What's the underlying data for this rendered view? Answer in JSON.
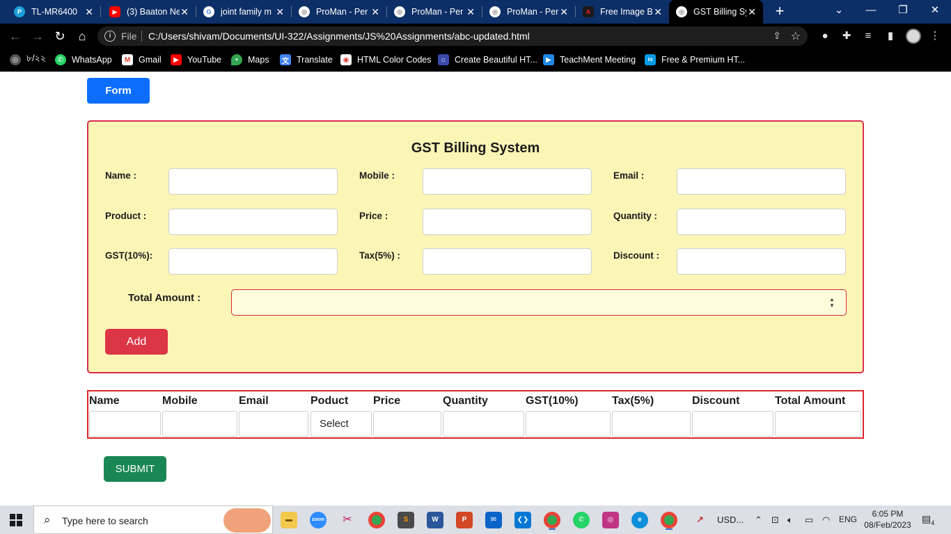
{
  "browser": {
    "tabs": [
      {
        "title": "TL-MR6400",
        "icon": "tplink-icon",
        "color": "#1aa0d8"
      },
      {
        "title": "(3) Baaton Ne",
        "icon": "youtube-icon",
        "color": "#ff0000"
      },
      {
        "title": "joint family m",
        "icon": "google-icon",
        "color": "#4285f4"
      },
      {
        "title": "ProMan - Per",
        "icon": "globe-icon",
        "color": "#3a3a3a"
      },
      {
        "title": "ProMan - Per",
        "icon": "globe-icon",
        "color": "#3a3a3a"
      },
      {
        "title": "ProMan - Per",
        "icon": "globe-icon",
        "color": "#3a3a3a"
      },
      {
        "title": "Free Image B",
        "icon": "adobe-icon",
        "color": "#e8232b"
      },
      {
        "title": "GST Billing Sy",
        "icon": "globe-icon",
        "color": "#3a3a3a"
      }
    ],
    "address": {
      "scheme_label": "File",
      "url": "C:/Users/shivam/Documents/UI-322/Assignments/JS%20Assignments/abc-updated.html"
    },
    "bookmarks": [
      {
        "label": "৮/২২",
        "icon": "globe-icon",
        "color": "#555555"
      },
      {
        "label": "WhatsApp",
        "icon": "whatsapp-icon",
        "color": "#25d366"
      },
      {
        "label": "Gmail",
        "icon": "gmail-icon",
        "color": "#ea4335"
      },
      {
        "label": "YouTube",
        "icon": "youtube-icon",
        "color": "#ff0000"
      },
      {
        "label": "Maps",
        "icon": "maps-icon",
        "color": "#34a853"
      },
      {
        "label": "Translate",
        "icon": "translate-icon",
        "color": "#4285f4"
      },
      {
        "label": "HTML Color Codes",
        "icon": "color-codes-icon",
        "color": "#e53935"
      },
      {
        "label": "Create Beautiful HT...",
        "icon": "html-template-icon",
        "color": "#3949ab"
      },
      {
        "label": "TeachMent Meeting",
        "icon": "teachment-icon",
        "color": "#1e88e5"
      },
      {
        "label": "Free & Premium HT...",
        "icon": "premium-html-icon",
        "color": "#039be5"
      }
    ]
  },
  "page": {
    "form_button": "Form",
    "title": "GST Billing System",
    "fields": {
      "name": "Name :",
      "mobile": "Mobile :",
      "email": "Email :",
      "product": "Product :",
      "price": "Price :",
      "quantity": "Quantity :",
      "gst": "GST(10%):",
      "tax": "Tax(5%) :",
      "discount": "Discount :"
    },
    "total_label": "Total Amount :",
    "add_button": "Add",
    "table": {
      "headers": [
        "Name",
        "Mobile",
        "Email",
        "Poduct",
        "Price",
        "Quantity",
        "GST(10%)",
        "Tax(5%)",
        "Discount",
        "Total Amount"
      ],
      "product_select": "Select"
    },
    "submit_button": "SUBMIT",
    "colors": {
      "card_bg": "#fbf6b6",
      "card_border": "#dc2c4f",
      "primary": "#0d6efd",
      "danger": "#dc3545",
      "success": "#198754"
    }
  },
  "taskbar": {
    "search_placeholder": "Type here to search",
    "tray_item": "USD...",
    "language": "ENG",
    "time": "6:05 PM",
    "date": "08/Feb/2023",
    "notifications": "4"
  }
}
